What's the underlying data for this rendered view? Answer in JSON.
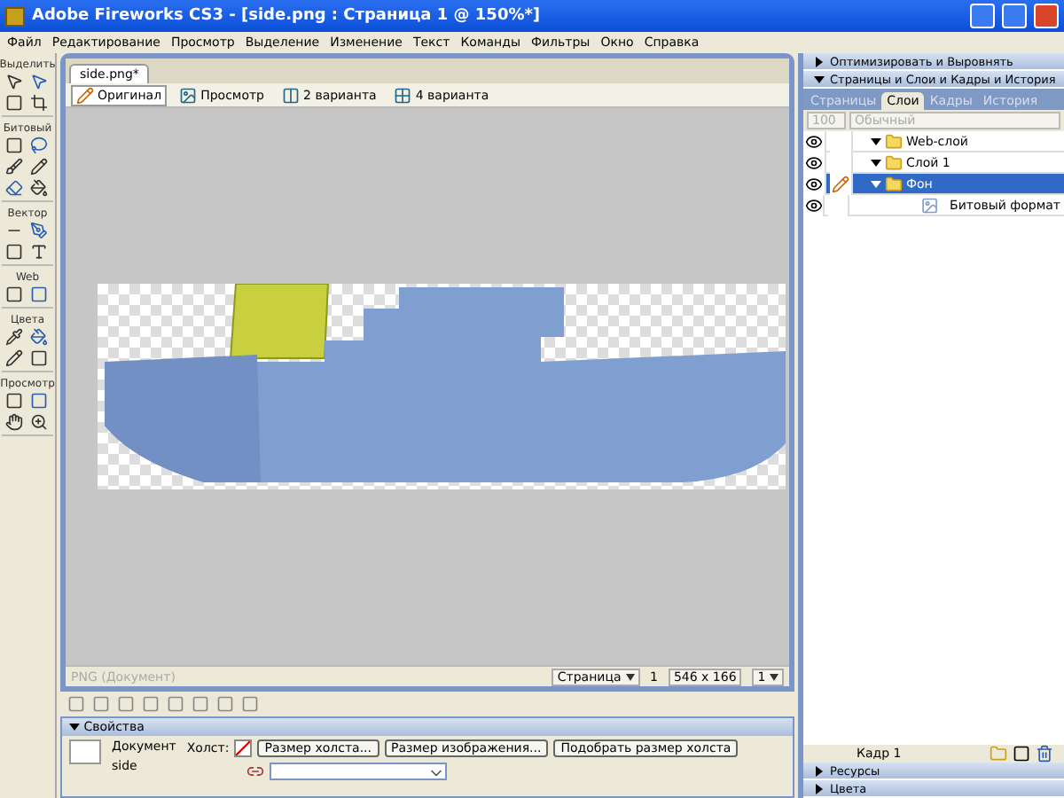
{
  "window": {
    "title": "Adobe Fireworks CS3 - [side.png : Страница 1 @ 150%*]"
  },
  "menu": [
    "Файл",
    "Редактирование",
    "Просмотр",
    "Выделение",
    "Изменение",
    "Текст",
    "Команды",
    "Фильтры",
    "Окно",
    "Справка"
  ],
  "tools": {
    "sections": [
      "Выделить",
      "Битовый",
      "Вектор",
      "Web",
      "Цвета",
      "Просмотр"
    ]
  },
  "document": {
    "tabs": [
      {
        "label": "side.png*",
        "selected": true
      }
    ],
    "views": [
      {
        "label": "Оригинал",
        "selected": true
      },
      {
        "label": "Просмотр",
        "selected": false
      },
      {
        "label": "2 варианта",
        "selected": false
      },
      {
        "label": "4 варианта",
        "selected": false
      }
    ],
    "status": {
      "doc_type": "PNG (Документ)",
      "page": "Страница",
      "frame": "1",
      "size": "546 x 166",
      "zoom": "1"
    }
  },
  "properties": {
    "title": "Свойства",
    "expanded": true,
    "doc_label": "Документ",
    "doc_name": "side",
    "canvas_label": "Холст:",
    "buttons": [
      "Размер холста...",
      "Размер изображения...",
      "Подобрать размер холста"
    ]
  },
  "panels": [
    {
      "title": "Оптимизировать и Выровнять",
      "expanded": false
    },
    {
      "title": "Страницы и Слои и Кадры и История",
      "expanded": true
    }
  ],
  "layers": {
    "tabs": [
      {
        "label": "Страницы",
        "selected": false
      },
      {
        "label": "Слои",
        "selected": true
      },
      {
        "label": "Кадры",
        "selected": false
      },
      {
        "label": "История",
        "selected": false
      }
    ],
    "opacity": "100",
    "blend": "Обычный",
    "rows": [
      {
        "name": "Web-слой",
        "kind": "folder",
        "selected": false,
        "expanded": true
      },
      {
        "name": "Слой 1",
        "kind": "folder",
        "selected": false,
        "expanded": true
      },
      {
        "name": "Фон",
        "kind": "folder",
        "selected": true,
        "expanded": true,
        "children": [
          {
            "name": "Битовый формат",
            "kind": "bitmap",
            "selected": false
          }
        ]
      }
    ],
    "frame": "Кадр 1"
  },
  "bottom_panels": [
    {
      "title": "Ресурсы",
      "expanded": false
    },
    {
      "title": "Цвета",
      "expanded": false
    }
  ]
}
